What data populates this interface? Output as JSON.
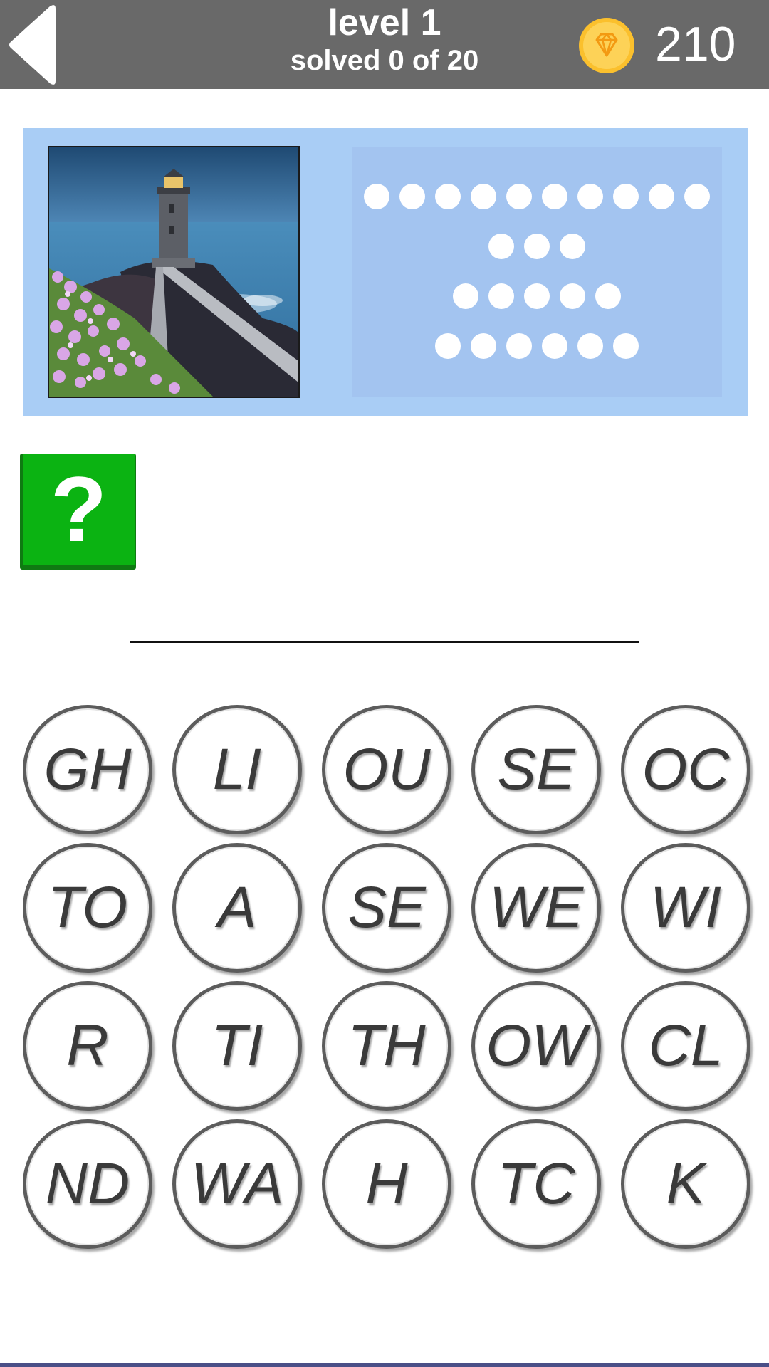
{
  "header": {
    "back_icon": "back-arrow-icon",
    "level_title": "level 1",
    "progress_text": "solved 0 of 20",
    "coin_icon": "diamond-coin-icon",
    "coin_count": "210"
  },
  "puzzle": {
    "image_subject": "lighthouse",
    "answer_word_lengths": [
      10,
      3,
      5,
      6
    ]
  },
  "hint": {
    "label": "?",
    "color": "#0bb312"
  },
  "tiles": [
    [
      "GH",
      "LI",
      "OU",
      "SE",
      "OC"
    ],
    [
      "TO",
      "A",
      "SE",
      "WE",
      "WI"
    ],
    [
      "R",
      "TI",
      "TH",
      "OW",
      "CL"
    ],
    [
      "ND",
      "WA",
      "H",
      "TC",
      "K"
    ]
  ],
  "colors": {
    "topbar": "#696969",
    "panel": "#a9cdf5",
    "slot_area": "#a3c4f0",
    "coin": "#fbc02d"
  }
}
